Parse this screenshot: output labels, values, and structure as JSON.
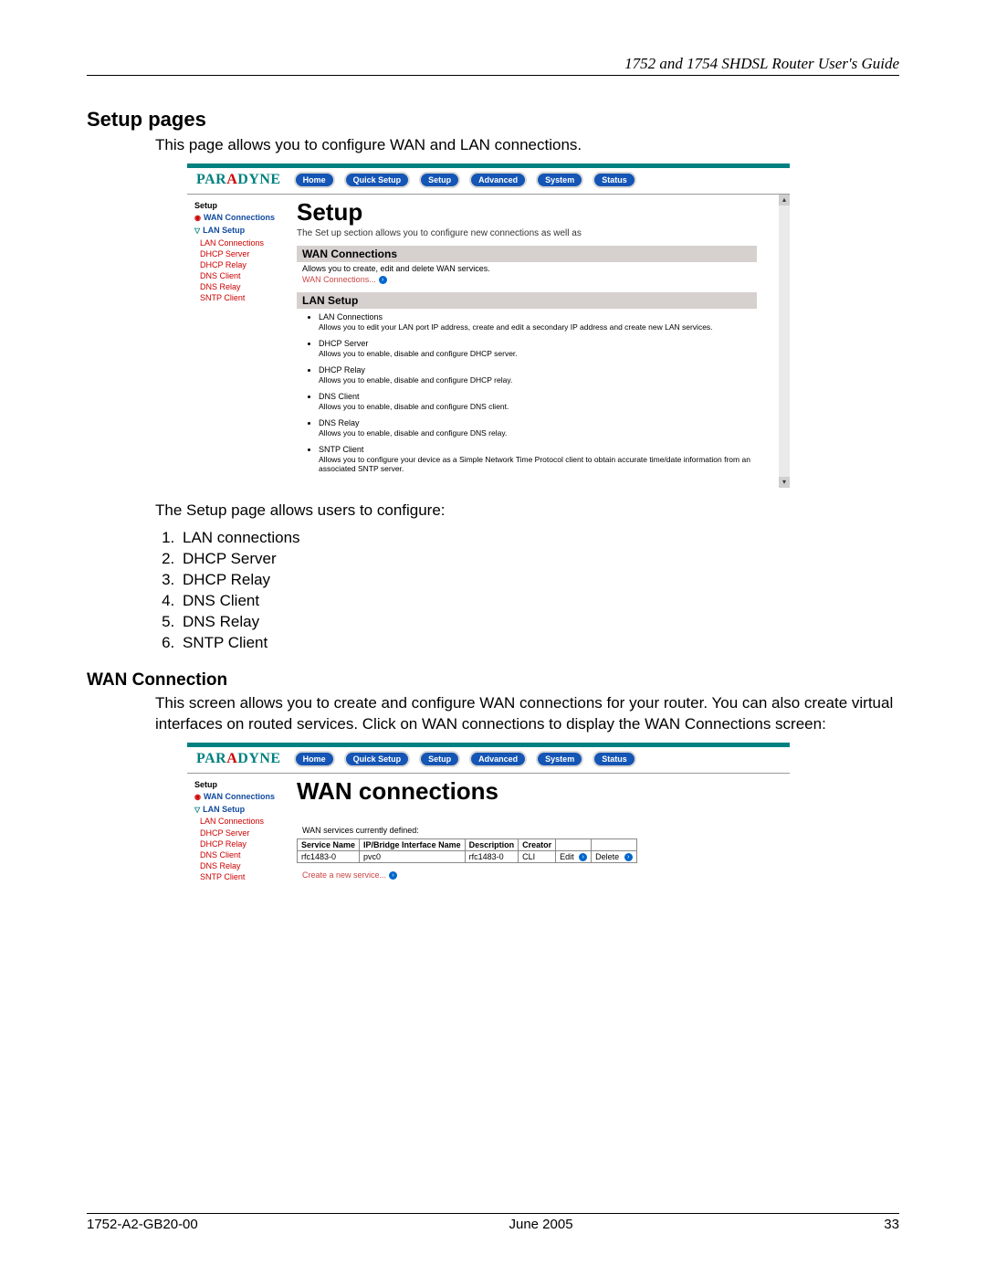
{
  "header": {
    "title": "1752 and 1754 SHDSL Router User's Guide"
  },
  "section1": {
    "title": "Setup pages",
    "intro": "This page allows you to configure WAN and LAN connections."
  },
  "shot1": {
    "logo": "PARADYNE",
    "nav": [
      "Home",
      "Quick Setup",
      "Setup",
      "Advanced",
      "System",
      "Status"
    ],
    "side": {
      "setup": "Setup",
      "wan": "WAN Connections",
      "lan": "LAN Setup",
      "sub": [
        "LAN Connections",
        "DHCP Server",
        "DHCP Relay",
        "DNS Client",
        "DNS Relay",
        "SNTP Client"
      ]
    },
    "h1": "Setup",
    "sub": "The Set up section allows you to configure new connections as well as",
    "band1": "WAN Connections",
    "band1_desc": "Allows you to create, edit and delete WAN services.",
    "band1_link": "WAN Connections...",
    "band2": "LAN Setup",
    "lan_items": [
      {
        "t": "LAN Connections",
        "d": "Allows you to edit your LAN port IP address, create and edit a secondary IP address and create new LAN services."
      },
      {
        "t": "DHCP Server",
        "d": "Allows you to enable, disable and configure DHCP server."
      },
      {
        "t": "DHCP Relay",
        "d": "Allows you to enable, disable and configure DHCP relay."
      },
      {
        "t": "DNS Client",
        "d": "Allows you to enable, disable and configure DNS client."
      },
      {
        "t": "DNS Relay",
        "d": "Allows you to enable, disable and configure DNS relay."
      },
      {
        "t": "SNTP Client",
        "d": "Allows you to configure your device as a Simple Network Time Protocol client to obtain accurate time/date information from an associated SNTP server."
      }
    ]
  },
  "after_shot1": {
    "line": "The Setup page allows users to configure:",
    "items": [
      "LAN connections",
      "DHCP Server",
      "DHCP Relay",
      "DNS Client",
      "DNS Relay",
      "SNTP Client"
    ]
  },
  "section2": {
    "title": "WAN Connection",
    "intro": "This screen allows you to create and configure WAN connections for your router. You can also create virtual interfaces on routed services. Click on WAN connections to display the WAN Connections screen:"
  },
  "shot2": {
    "h1": "WAN connections",
    "defined": "WAN services currently defined:",
    "headers": [
      "Service Name",
      "IP/Bridge Interface Name",
      "Description",
      "Creator",
      "",
      ""
    ],
    "row": [
      "rfc1483-0",
      "pvc0",
      "rfc1483-0",
      "CLI",
      "Edit",
      "Delete"
    ],
    "create": "Create a new service..."
  },
  "footer": {
    "left": "1752-A2-GB20-00",
    "mid": "June 2005",
    "right": "33"
  }
}
